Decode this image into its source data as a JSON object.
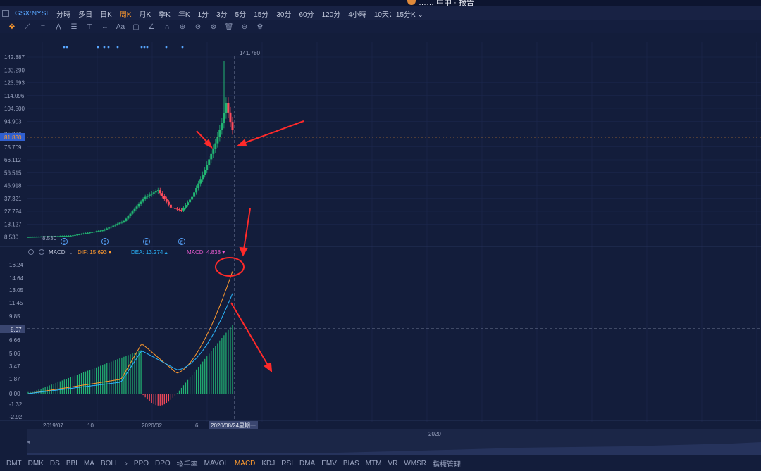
{
  "header": {
    "user_text": "…… 中中 · 报告"
  },
  "symbol": "GSX:NYSE",
  "periods": [
    {
      "label": "分時",
      "active": false
    },
    {
      "label": "多日",
      "active": false
    },
    {
      "label": "日K",
      "active": false
    },
    {
      "label": "周K",
      "active": true
    },
    {
      "label": "月K",
      "active": false
    },
    {
      "label": "季K",
      "active": false
    },
    {
      "label": "年K",
      "active": false
    },
    {
      "label": "1分",
      "active": false
    },
    {
      "label": "3分",
      "active": false
    },
    {
      "label": "5分",
      "active": false
    },
    {
      "label": "15分",
      "active": false
    },
    {
      "label": "30分",
      "active": false
    },
    {
      "label": "60分",
      "active": false
    },
    {
      "label": "120分",
      "active": false
    },
    {
      "label": "4小時",
      "active": false
    },
    {
      "label": "10天：15分K ⌄",
      "active": false
    }
  ],
  "toolbar_icons": [
    "crosshair-icon",
    "line-tool-icon",
    "channel-tool-icon",
    "pattern-tool-icon",
    "fib-tool-icon",
    "measure-tool-icon",
    "arrow-tool-icon",
    "text-tool-icon",
    "note-tool-icon",
    "angle-tool-icon",
    "magnet-icon",
    "lock-icon",
    "eye-icon",
    "hide-icon",
    "trash-icon",
    "link-icon",
    "settings-icon"
  ],
  "toolbar_glyphs": [
    "✥",
    "⟋",
    "⌗",
    "⋀",
    "☰",
    "⊤",
    "←",
    "Aa",
    "▢",
    "∠",
    "∩",
    "⊕",
    "⊘",
    "⊗",
    "🗑",
    "⊖",
    "⚙"
  ],
  "colors": {
    "up": "#22b573",
    "down": "#ff4b5c",
    "dif": "#ff9a2e",
    "dea": "#2bb8ff",
    "macd": "#e85bd0",
    "arrow": "#ff2a2a",
    "accent": "#ff9a2e"
  },
  "price_axis": {
    "ticks": [
      "142.887",
      "133.290",
      "123.693",
      "114.096",
      "104.500",
      "94.903",
      "85.306",
      "75.709",
      "66.112",
      "56.515",
      "46.918",
      "37.321",
      "27.724",
      "18.127",
      "8.530"
    ],
    "current_label": "81.830",
    "high_label": "141.780",
    "low_label": "8.530"
  },
  "event_markers": [
    "E",
    "E",
    "E",
    "E"
  ],
  "macd_legend": {
    "name": "MACD",
    "dif": "DIF: 15.693 ▾",
    "dea": "DEA: 13.274 ▴",
    "macd": "MACD: 4.838 ▾"
  },
  "macd_axis": {
    "ticks": [
      "16.24",
      "14.64",
      "13.05",
      "11.45",
      "9.85",
      "8.07",
      "6.66",
      "5.06",
      "3.47",
      "1.87",
      "0.00",
      "-1.32",
      "-2.92"
    ],
    "current_label": "8.07"
  },
  "date_axis": {
    "labels": [
      "2019/07",
      "10",
      "2020/02",
      "6"
    ],
    "cursor_label": "2020/08/24星期一"
  },
  "navigator": {
    "year_label": "2020"
  },
  "indicators": [
    {
      "label": "DMT",
      "active": false
    },
    {
      "label": "DMK",
      "active": false
    },
    {
      "label": "DS",
      "active": false
    },
    {
      "label": "BBI",
      "active": false
    },
    {
      "label": "MA",
      "active": false
    },
    {
      "label": "BOLL",
      "active": false
    },
    {
      "label": "›",
      "active": false
    },
    {
      "label": "PPO",
      "active": false
    },
    {
      "label": "DPO",
      "active": false
    },
    {
      "label": "換手率",
      "active": false
    },
    {
      "label": "MAVOL",
      "active": false
    },
    {
      "label": "MACD",
      "active": true
    },
    {
      "label": "KDJ",
      "active": false
    },
    {
      "label": "RSI",
      "active": false
    },
    {
      "label": "DMA",
      "active": false
    },
    {
      "label": "EMV",
      "active": false
    },
    {
      "label": "BIAS",
      "active": false
    },
    {
      "label": "MTM",
      "active": false
    },
    {
      "label": "VR",
      "active": false
    },
    {
      "label": "WMSR",
      "active": false
    },
    {
      "label": "指標管理",
      "active": false
    }
  ]
}
